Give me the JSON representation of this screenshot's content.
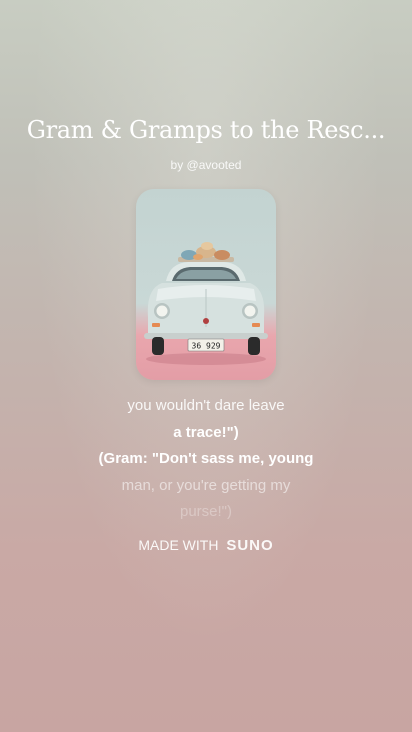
{
  "song": {
    "title": "Gram & Gramps to the Resc...",
    "byline": "by @avooted",
    "cover_image": "vintage-car-with-luggage-cover"
  },
  "lyrics": [
    "you wouldn't dare leave",
    "a trace!\")",
    "(Gram: \"Don't sass me, young",
    "man, or you're getting my",
    "purse!\")"
  ],
  "footer": {
    "made_with": "MADE WITH",
    "brand": "SUNO"
  },
  "cover_art": {
    "license_plate": "36 929"
  },
  "colors": {
    "text": "#ffffff",
    "background_top": "#c8cdc2",
    "background_bottom": "#c8a5a2",
    "car_body": "#d6e1df",
    "cover_floor": "#e39da6"
  }
}
